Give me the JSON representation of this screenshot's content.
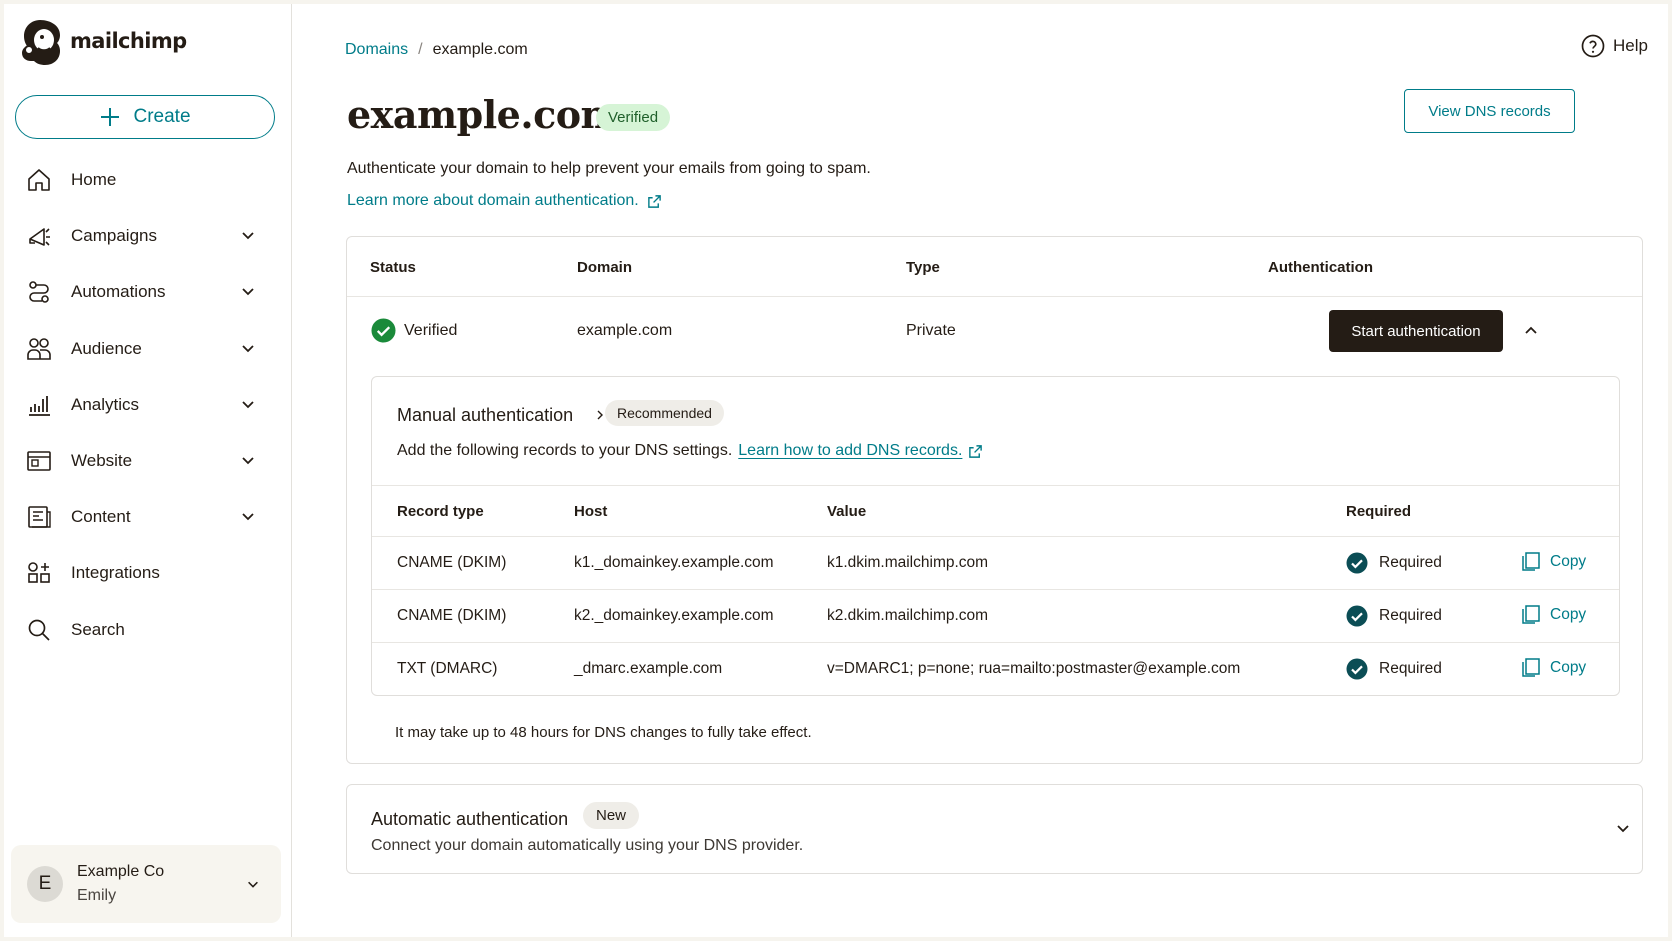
{
  "brand": {
    "name": "mailchimp",
    "accent": "#007c89",
    "dark": "#241c15",
    "verified_bg": "#d6f4d6",
    "success": "#1a8a3a"
  },
  "sidebar": {
    "create_label": "Create",
    "items": [
      {
        "label": "Home",
        "icon": "home-icon",
        "has_chevron": false
      },
      {
        "label": "Campaigns",
        "icon": "megaphone-icon",
        "has_chevron": true
      },
      {
        "label": "Automations",
        "icon": "automations-icon",
        "has_chevron": true
      },
      {
        "label": "Audience",
        "icon": "audience-icon",
        "has_chevron": true
      },
      {
        "label": "Analytics",
        "icon": "bar-chart-icon",
        "has_chevron": true
      },
      {
        "label": "Website",
        "icon": "website-icon",
        "has_chevron": true
      },
      {
        "label": "Content",
        "icon": "content-icon",
        "has_chevron": true
      },
      {
        "label": "Integrations",
        "icon": "integrations-icon",
        "has_chevron": false
      },
      {
        "label": "Search",
        "icon": "search-icon",
        "has_chevron": false
      }
    ],
    "account": {
      "initial": "E",
      "company": "Example Co",
      "user": "Emily"
    }
  },
  "header": {
    "breadcrumb": {
      "parent": "Domains",
      "separator": "/",
      "current": "example.com"
    },
    "help_label": "Help"
  },
  "page": {
    "title": "example.com",
    "status_badge": "Verified",
    "view_dns_button": "View DNS records",
    "description": "Authenticate your domain to help prevent your emails from going to spam.",
    "learn_more": "Learn more about domain authentication."
  },
  "domain_table": {
    "columns": {
      "status": "Status",
      "domain": "Domain",
      "type": "Type",
      "authentication": "Authentication"
    },
    "row": {
      "status": "Verified",
      "domain": "example.com",
      "type": "Private",
      "action": "Start authentication"
    }
  },
  "manual_auth": {
    "title": "Manual authentication",
    "badge": "Recommended",
    "description": "Add the following records to your DNS settings.",
    "link": "Learn how to add DNS records.",
    "columns": {
      "record_type": "Record type",
      "host": "Host",
      "value": "Value",
      "required": "Required"
    },
    "records": [
      {
        "record_type": "CNAME (DKIM)",
        "host": "k1._domainkey.example.com",
        "value": "k1.dkim.mailchimp.com",
        "required": "Required",
        "copy": "Copy"
      },
      {
        "record_type": "CNAME (DKIM)",
        "host": "k2._domainkey.example.com",
        "value": "k2.dkim.mailchimp.com",
        "required": "Required",
        "copy": "Copy"
      },
      {
        "record_type": "TXT (DMARC)",
        "host": "_dmarc.example.com",
        "value": "v=DMARC1; p=none; rua=mailto:postmaster@example.com",
        "required": "Required",
        "copy": "Copy"
      }
    ],
    "note": "It may take up to 48 hours for DNS changes to fully take effect."
  },
  "auto_auth": {
    "title": "Automatic authentication",
    "badge": "New",
    "description": "Connect your domain automatically using your DNS provider."
  }
}
